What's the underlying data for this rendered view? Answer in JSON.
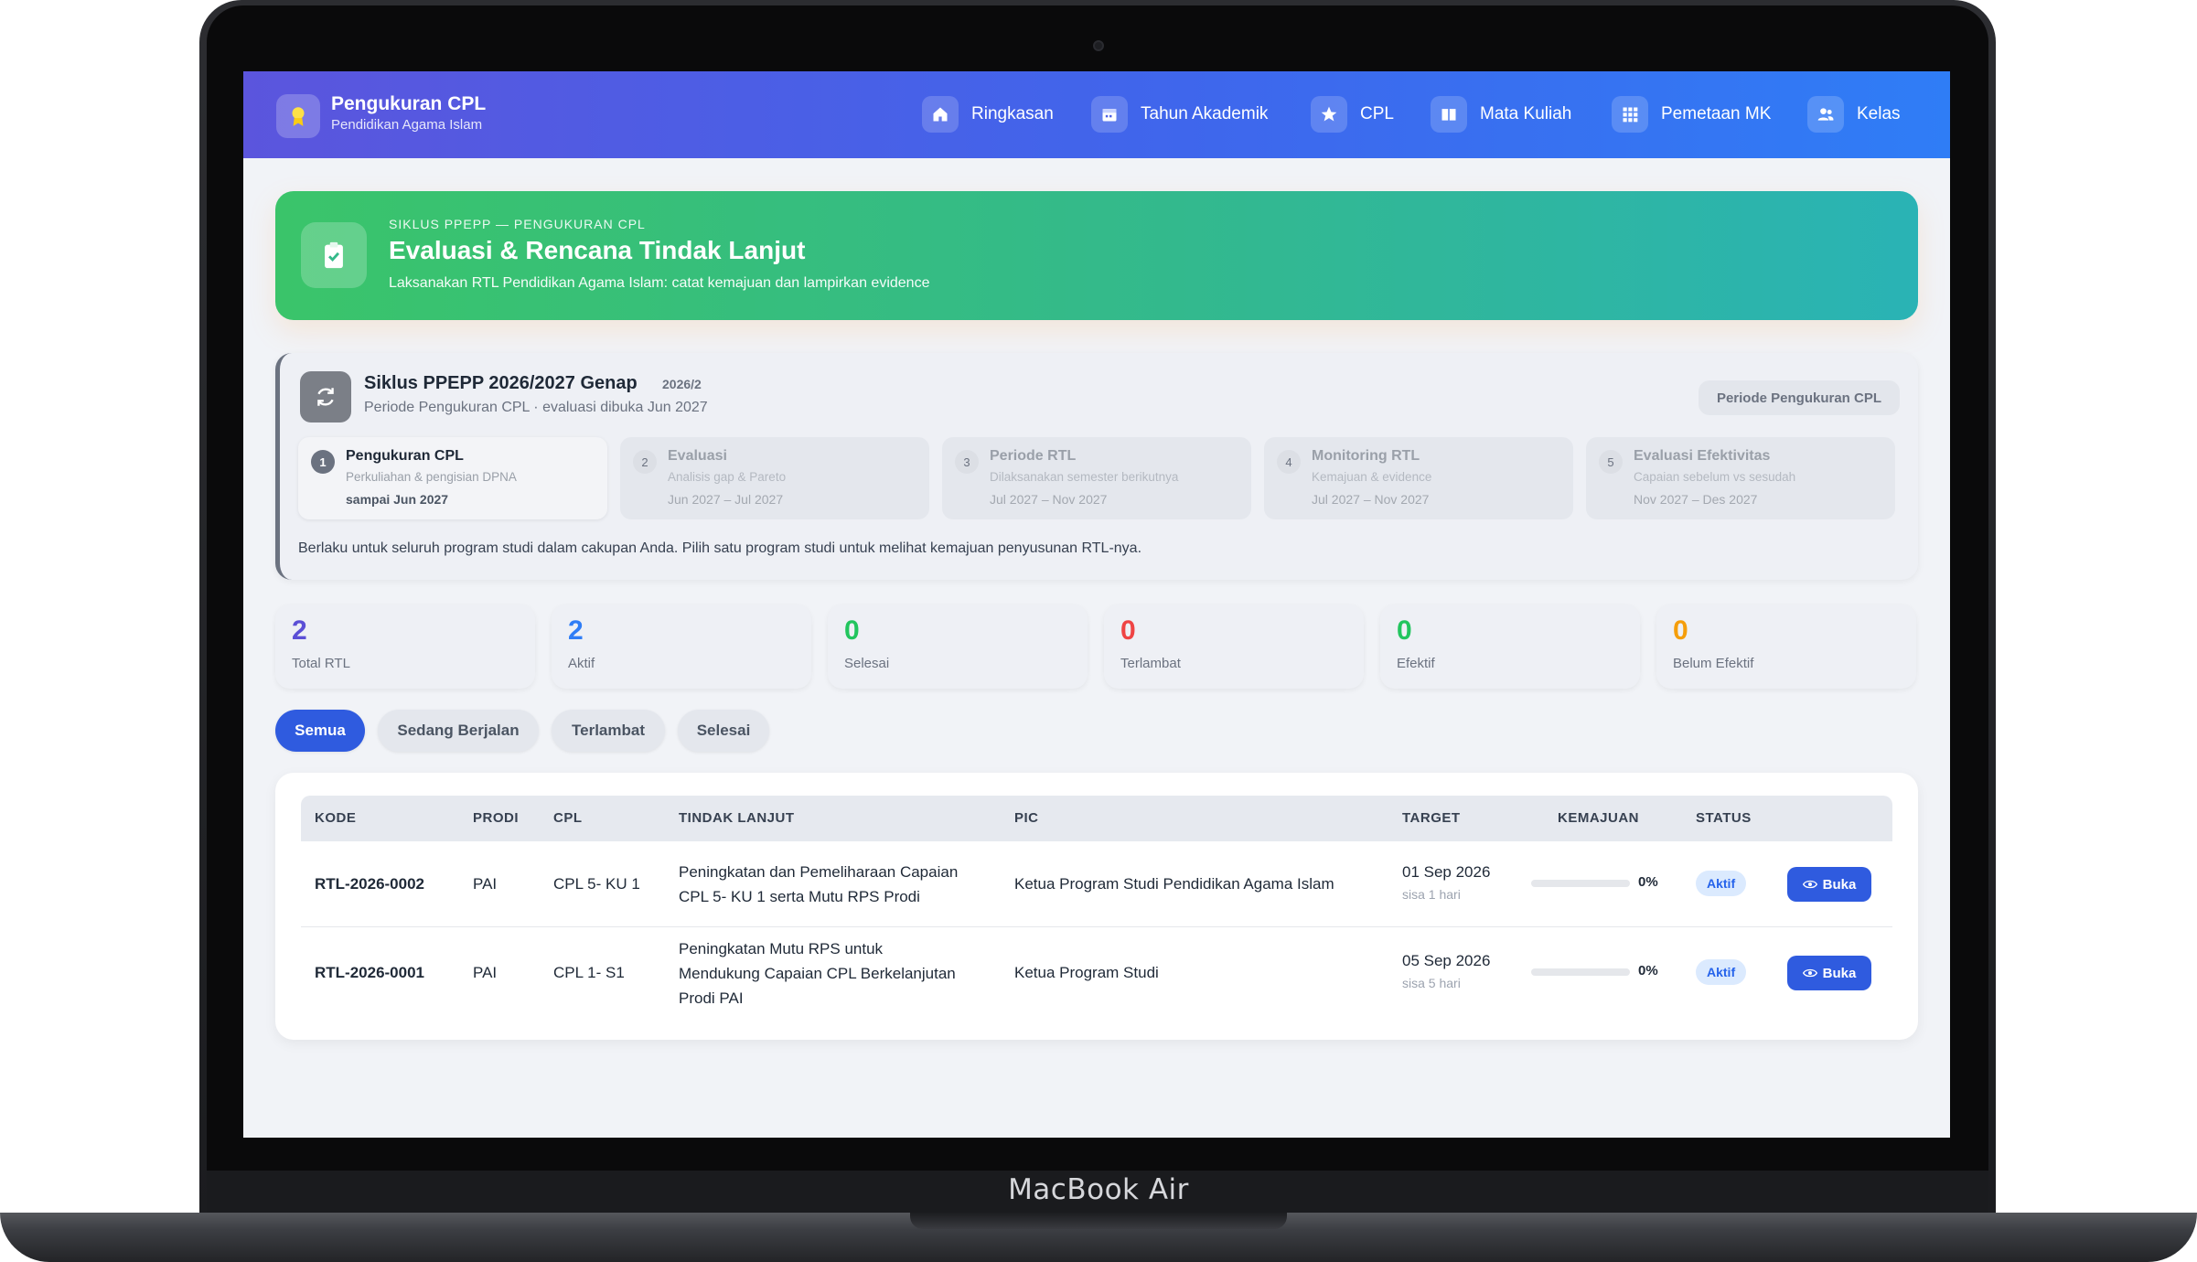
{
  "device": {
    "brand": "MacBook Air"
  },
  "app": {
    "title": "Pengukuran CPL",
    "subtitle": "Pendidikan Agama Islam",
    "logo_icon": "award-icon"
  },
  "nav": {
    "items": [
      {
        "label": "Ringkasan",
        "icon": "home-icon"
      },
      {
        "label": "Tahun Akademik",
        "icon": "calendar-icon"
      },
      {
        "label": "CPL",
        "icon": "star-icon"
      },
      {
        "label": "Mata Kuliah",
        "icon": "book-icon"
      },
      {
        "label": "Pemetaan MK",
        "icon": "grid-icon"
      },
      {
        "label": "Kelas",
        "icon": "users-icon"
      }
    ]
  },
  "hero": {
    "kicker": "SIKLUS PPEPP — PENGUKURAN CPL",
    "title": "Evaluasi & Rencana Tindak Lanjut",
    "description": "Laksanakan RTL Pendidikan Agama Islam: catat kemajuan dan lampirkan evidence",
    "icon": "clipboard-check-icon"
  },
  "cycle": {
    "title": "Siklus PPEPP 2026/2027 Genap",
    "code": "2026/2",
    "subtitle": "Periode Pengukuran CPL · evaluasi dibuka Jun 2027",
    "badge": "Periode Pengukuran CPL",
    "icon": "refresh-icon",
    "steps": [
      {
        "num": "1",
        "name": "Pengukuran CPL",
        "desc": "Perkuliahan & pengisian DPNA",
        "date": "sampai Jun 2027",
        "active": true
      },
      {
        "num": "2",
        "name": "Evaluasi",
        "desc": "Analisis gap & Pareto",
        "date": "Jun 2027 – Jul 2027",
        "active": false
      },
      {
        "num": "3",
        "name": "Periode RTL",
        "desc": "Dilaksanakan semester berikutnya",
        "date": "Jul 2027 – Nov 2027",
        "active": false
      },
      {
        "num": "4",
        "name": "Monitoring RTL",
        "desc": "Kemajuan & evidence",
        "date": "Jul 2027 – Nov 2027",
        "active": false
      },
      {
        "num": "5",
        "name": "Evaluasi Efektivitas",
        "desc": "Capaian sebelum vs sesudah",
        "date": "Nov 2027 – Des 2027",
        "active": false
      }
    ],
    "note": "Berlaku untuk seluruh program studi dalam cakupan Anda. Pilih satu program studi untuk melihat kemajuan penyusunan RTL-nya."
  },
  "stats": [
    {
      "value": "2",
      "label": "Total RTL",
      "color": "#5b4fd6"
    },
    {
      "value": "2",
      "label": "Aktif",
      "color": "#2f7df6"
    },
    {
      "value": "0",
      "label": "Selesai",
      "color": "#22c55e"
    },
    {
      "value": "0",
      "label": "Terlambat",
      "color": "#ef4444"
    },
    {
      "value": "0",
      "label": "Efektif",
      "color": "#22c55e"
    },
    {
      "value": "0",
      "label": "Belum Efektif",
      "color": "#f59e0b"
    }
  ],
  "filters": [
    {
      "label": "Semua",
      "active": true
    },
    {
      "label": "Sedang Berjalan",
      "active": false
    },
    {
      "label": "Terlambat",
      "active": false
    },
    {
      "label": "Selesai",
      "active": false
    }
  ],
  "table": {
    "columns": [
      "KODE",
      "PRODI",
      "CPL",
      "TINDAK LANJUT",
      "PIC",
      "TARGET",
      "KEMAJUAN",
      "STATUS"
    ],
    "rows": [
      {
        "kode": "RTL-2026-0002",
        "prodi": "PAI",
        "cpl": "CPL 5- KU 1",
        "tindak_lanjut": [
          "Peningkatan dan Pemeliharaan Capaian",
          "CPL 5- KU 1 serta Mutu RPS Prodi"
        ],
        "pic": "Ketua Program Studi Pendidikan Agama Islam",
        "target": "01 Sep 2026",
        "target_note": "sisa 1 hari",
        "progress": 0,
        "progress_label": "0%",
        "status": "Aktif",
        "action": "Buka"
      },
      {
        "kode": "RTL-2026-0001",
        "prodi": "PAI",
        "cpl": "CPL 1- S1",
        "tindak_lanjut": [
          "Peningkatan Mutu RPS untuk",
          "Mendukung Capaian CPL Berkelanjutan",
          "Prodi PAI"
        ],
        "pic": "Ketua Program Studi",
        "target": "05 Sep 2026",
        "target_note": "sisa 5 hari",
        "progress": 0,
        "progress_label": "0%",
        "status": "Aktif",
        "action": "Buka"
      }
    ]
  }
}
